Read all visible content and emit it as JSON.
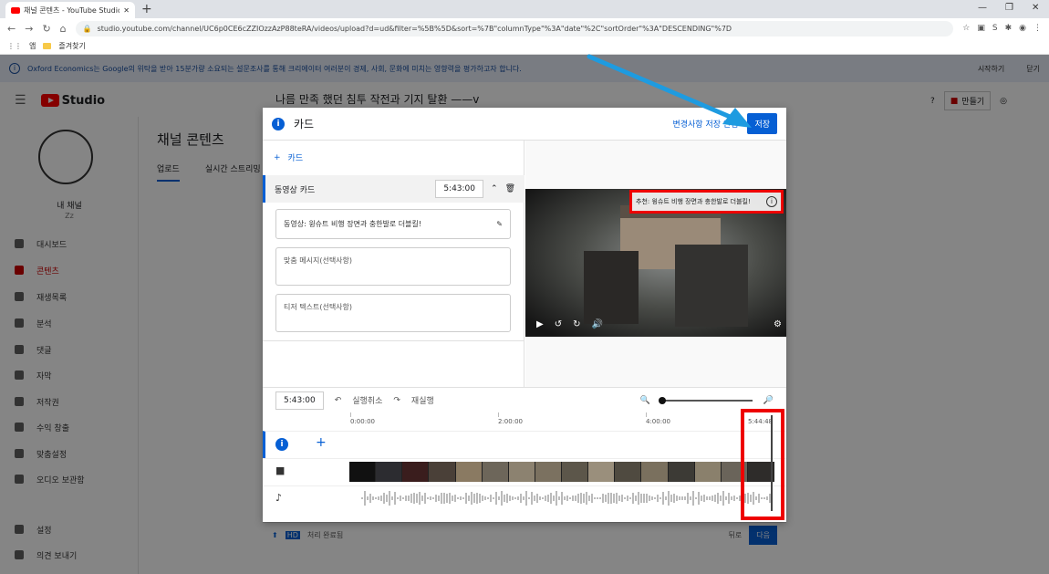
{
  "browser": {
    "tab_title": "채널 콘텐츠 - YouTube Studio",
    "url": "studio.youtube.com/channel/UC6p0CE6cZZIOzzAzP88teRA/videos/upload?d=ud&filter=%5B%5D&sort=%7B\"columnType\"%3A\"date\"%2C\"sortOrder\"%3A\"DESCENDING\"%7D",
    "bookmarks": [
      "앱",
      "즐겨찾기"
    ]
  },
  "banner": {
    "message": "Oxford Economics는 Google의 위탁을 받아 15분가량 소요되는 설문조사를 통해 크리에이터 여러분이 경제, 사회, 문화에 미치는 영향력을 평가하고자 합니다.",
    "start": "시작하기",
    "close": "닫기"
  },
  "studio": {
    "logo": "Studio",
    "create": "만들기",
    "channel_name": "내 채널",
    "channel_sub": "Zz",
    "nav": [
      "대시보드",
      "콘텐츠",
      "재생목록",
      "분석",
      "댓글",
      "자막",
      "저작권",
      "수익 창출",
      "맞춤설정",
      "오디오 보관함"
    ],
    "nav_bottom": [
      "설정",
      "의견 보내기"
    ],
    "content_title": "채널 콘텐츠",
    "tabs": [
      "업로드",
      "실시간 스트리밍"
    ]
  },
  "upload_dialog": {
    "title": "나름 만족 했던 침투 작전과 기지 탈환 ——v",
    "status": "처리 완료됨",
    "back": "뒤로",
    "next": "다음"
  },
  "card_editor": {
    "title": "카드",
    "save_changes": "변경사항 저장 안됨",
    "save": "저장",
    "add_card": "카드",
    "card_label": "동영상 카드",
    "card_time": "5:43:00",
    "card_video": "동영상: 윙슈트 비행 장면과 충한발로 더블킬!",
    "custom_message_placeholder": "맞춤 메시지(선택사항)",
    "teaser_placeholder": "티저 텍스트(선택사항)",
    "teaser_preview": "추천: 윙슈트 비행 장면과 충한발로 더블킬!"
  },
  "timeline": {
    "time": "5:43:00",
    "undo": "실행취소",
    "redo": "재실행",
    "zoom_level": 0,
    "ticks": [
      "0:00:00",
      "2:00:00",
      "4:00:00",
      "5:44:48"
    ],
    "playhead_fraction": 0.99
  },
  "colors": {
    "accent": "#065fd4",
    "highlight": "#e00000",
    "arrow": "#1e9be0"
  }
}
